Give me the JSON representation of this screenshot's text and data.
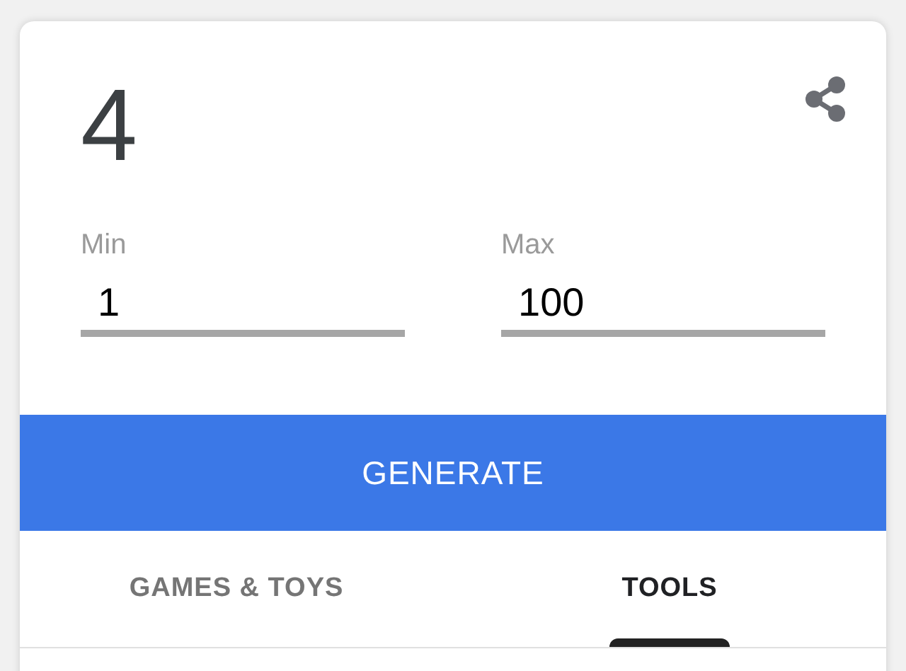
{
  "result": "4",
  "fields": [
    {
      "label": "Min",
      "value": "1"
    },
    {
      "label": "Max",
      "value": "100"
    }
  ],
  "generate_button": "GENERATE",
  "tabs": [
    {
      "label": "GAMES & TOYS",
      "selected": false
    },
    {
      "label": "TOOLS",
      "selected": true
    }
  ]
}
